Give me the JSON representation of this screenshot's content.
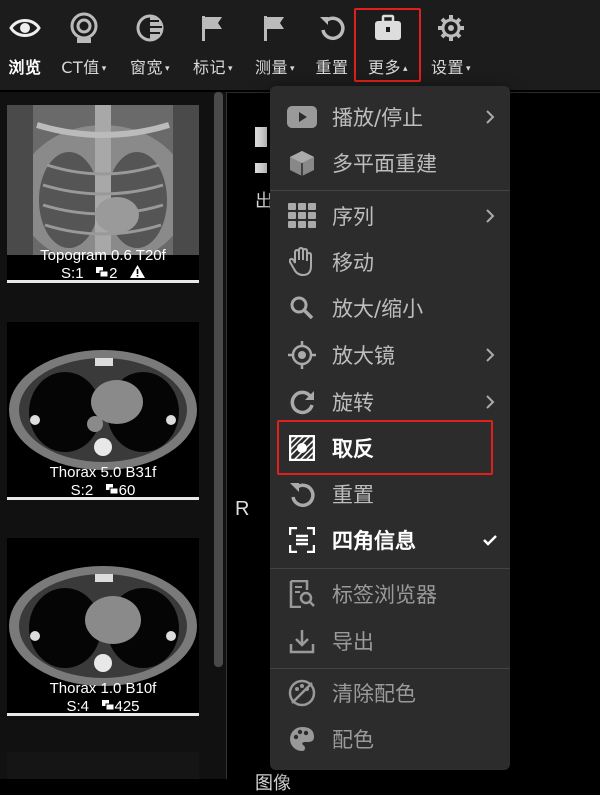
{
  "toolbar": {
    "items": [
      {
        "label": "浏览",
        "icon": "eye-icon",
        "caret": false,
        "active": true
      },
      {
        "label": "CT值",
        "icon": "probe-icon",
        "caret": true
      },
      {
        "label": "窗宽",
        "icon": "contrast-icon",
        "caret": true
      },
      {
        "label": "标记",
        "icon": "flag-icon",
        "caret": true
      },
      {
        "label": "测量",
        "icon": "flag-measure-icon",
        "caret": true
      },
      {
        "label": "重置",
        "icon": "reset-icon",
        "caret": false
      },
      {
        "label": "更多",
        "icon": "toolbox-icon",
        "caret": true,
        "highlighted": true
      },
      {
        "label": "设置",
        "icon": "gear-icon",
        "caret": true
      }
    ],
    "caret_down": "▾",
    "caret_up": "▴"
  },
  "series": [
    {
      "name": "Topogram 0.6 T20f",
      "series_no": "S:1",
      "count": "2",
      "warning": true
    },
    {
      "name": "Thorax 5.0 B31f",
      "series_no": "S:2",
      "count": "60",
      "warning": false
    },
    {
      "name": "Thorax 1.0 B10f",
      "series_no": "S:4",
      "count": "425",
      "warning": false
    }
  ],
  "viewer": {
    "orientation_left": "R",
    "partial_top_text": "出",
    "partial_bottom_text": "图像"
  },
  "menu": {
    "items": [
      {
        "label": "播放/停止",
        "icon": "play-icon",
        "submenu": true
      },
      {
        "label": "多平面重建",
        "icon": "cube-icon",
        "submenu": false
      },
      {
        "label": "序列",
        "icon": "grid-icon",
        "submenu": true
      },
      {
        "label": "移动",
        "icon": "hand-icon",
        "submenu": false
      },
      {
        "label": "放大/缩小",
        "icon": "magnify-icon",
        "submenu": false
      },
      {
        "label": "放大镜",
        "icon": "target-icon",
        "submenu": true
      },
      {
        "label": "旋转",
        "icon": "rotate-icon",
        "submenu": true
      },
      {
        "label": "取反",
        "icon": "invert-icon",
        "submenu": false,
        "highlighted": true
      },
      {
        "label": "重置",
        "icon": "reset-icon",
        "submenu": false
      },
      {
        "label": "四角信息",
        "icon": "corner-info-icon",
        "submenu": false,
        "checked": true
      },
      {
        "label": "标签浏览器",
        "icon": "tag-browser-icon",
        "submenu": false
      },
      {
        "label": "导出",
        "icon": "export-icon",
        "submenu": false
      },
      {
        "label": "清除配色",
        "icon": "palette-clear-icon",
        "submenu": false
      },
      {
        "label": "配色",
        "icon": "palette-icon",
        "submenu": false
      }
    ]
  },
  "colors": {
    "highlight": "#e0201a",
    "toolbar_bg": "#1c1c1c",
    "menu_bg": "#2c2c2c"
  }
}
